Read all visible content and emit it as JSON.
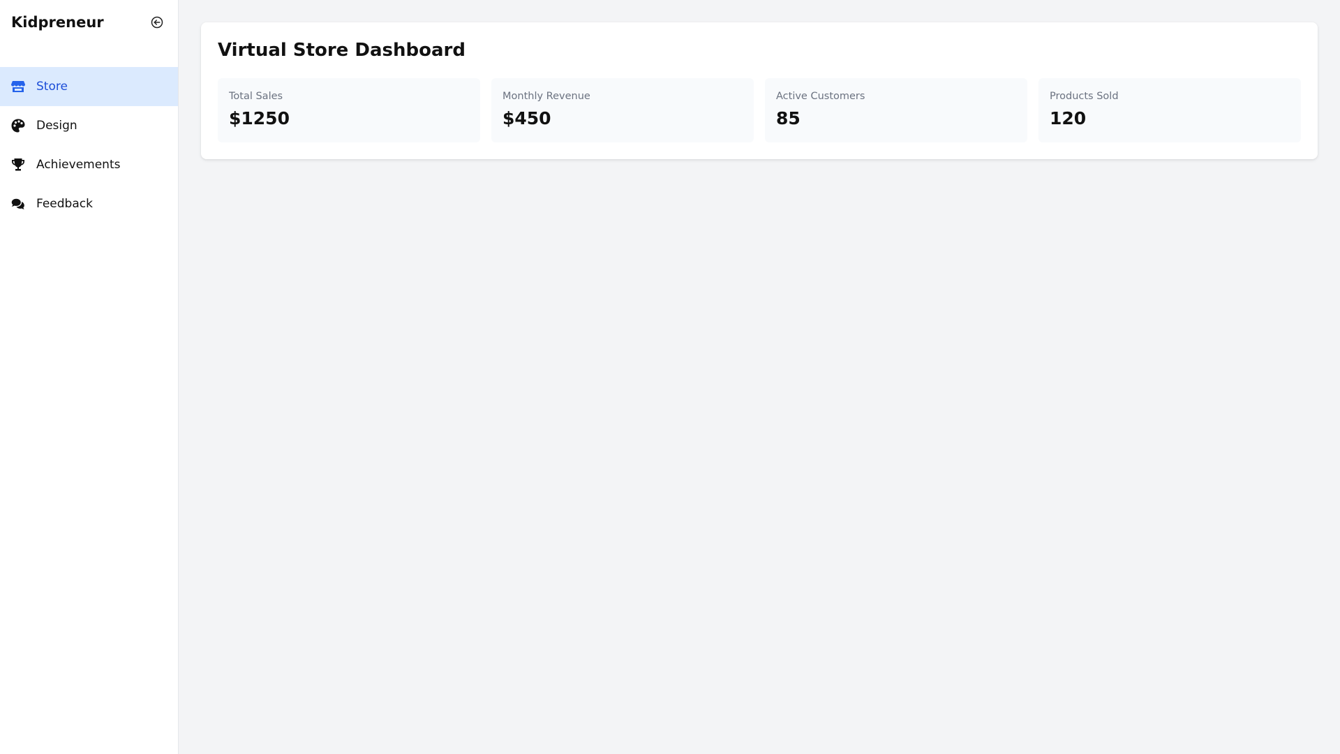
{
  "sidebar": {
    "brand": "Kidpreneur",
    "collapse_icon": "collapse-left-icon",
    "items": [
      {
        "label": "Store",
        "icon": "store-icon",
        "active": true
      },
      {
        "label": "Design",
        "icon": "palette-icon",
        "active": false
      },
      {
        "label": "Achievements",
        "icon": "trophy-icon",
        "active": false
      },
      {
        "label": "Feedback",
        "icon": "comments-icon",
        "active": false
      }
    ]
  },
  "main": {
    "title": "Virtual Store Dashboard",
    "stats": [
      {
        "label": "Total Sales",
        "value": "$1250"
      },
      {
        "label": "Monthly Revenue",
        "value": "$450"
      },
      {
        "label": "Active Customers",
        "value": "85"
      },
      {
        "label": "Products Sold",
        "value": "120"
      }
    ]
  },
  "colors": {
    "accent": "#1d4ed8",
    "active_bg": "#dbeafe",
    "page_bg": "#f3f4f6",
    "card_bg": "#f8fafc"
  }
}
